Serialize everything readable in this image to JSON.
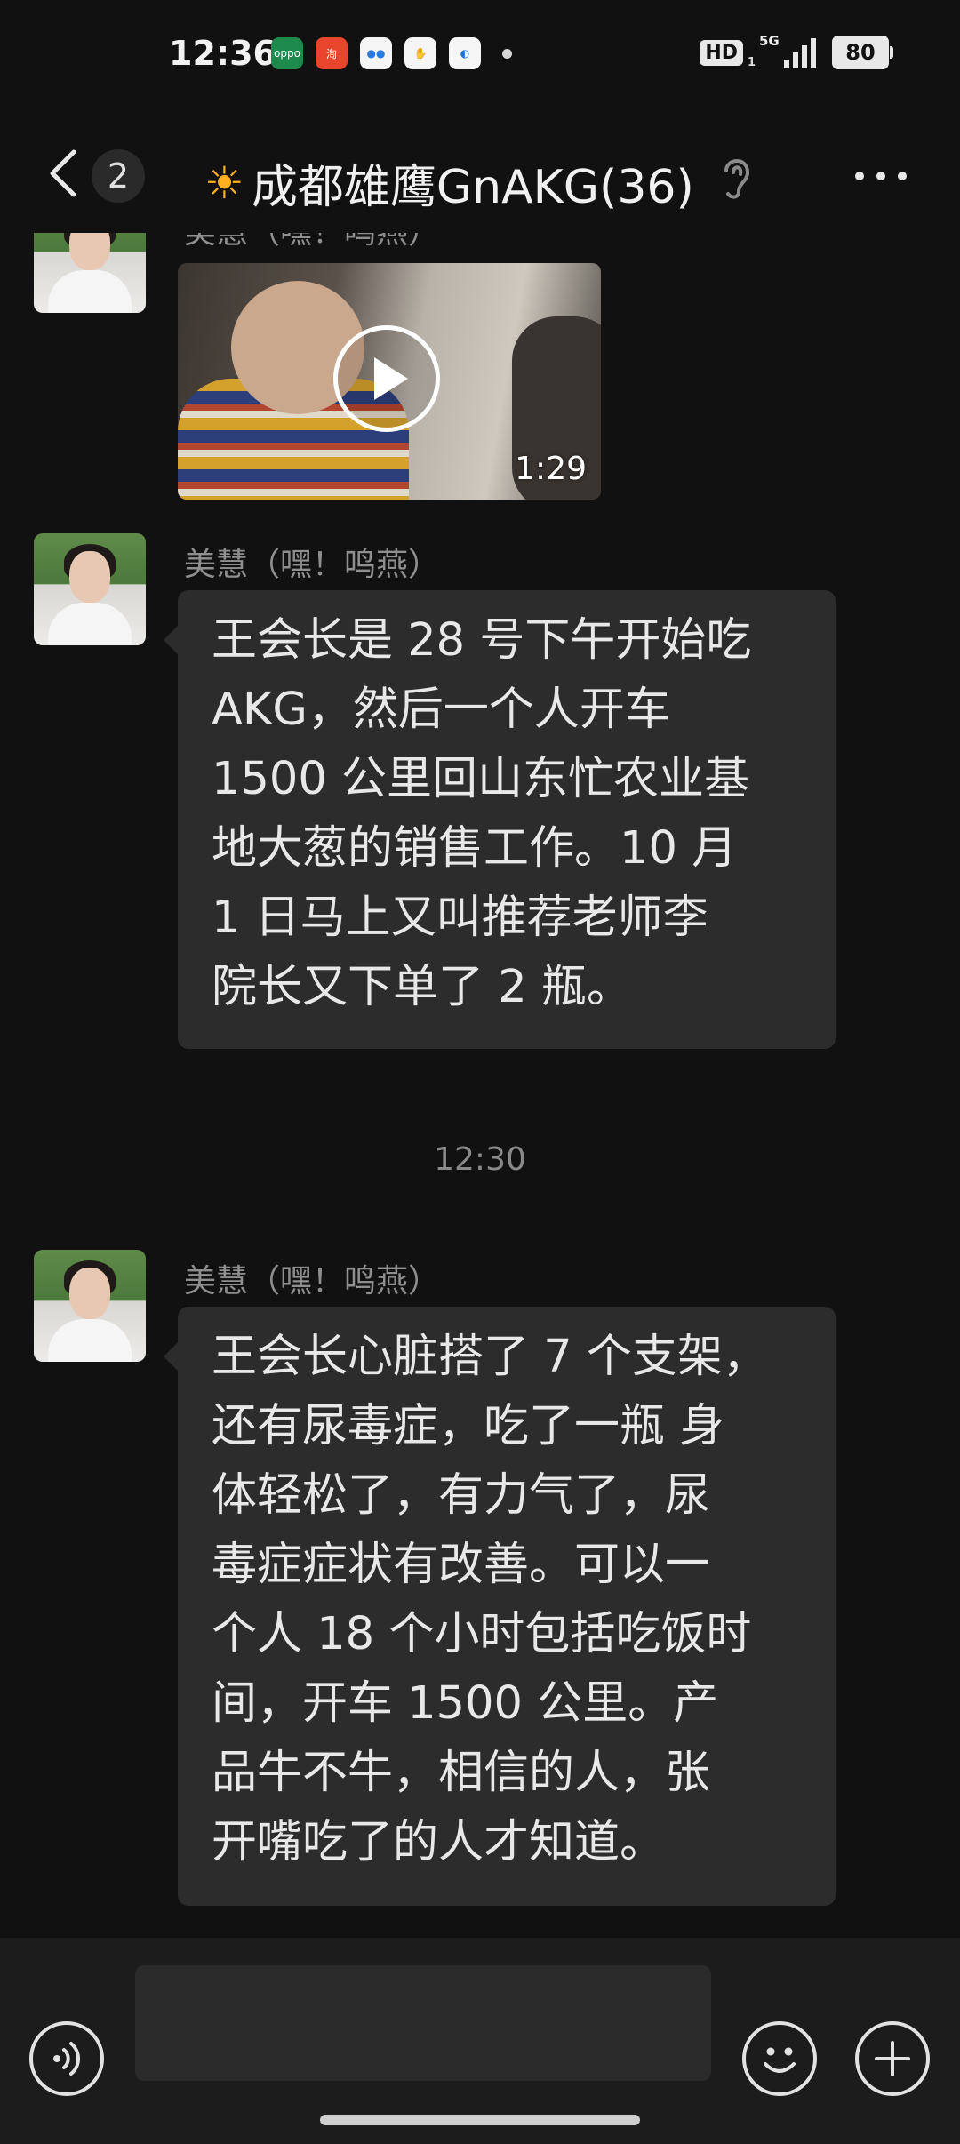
{
  "status_bar": {
    "time": "12:36",
    "app_icons": [
      "oppo-icon",
      "taobao-icon",
      "chat-bubble-icon",
      "baidu-paw-icon",
      "browser-icon"
    ],
    "hd_label": "HD",
    "hd_sub": "1",
    "network": "5G",
    "battery": "80"
  },
  "header": {
    "unread_count": "2",
    "title_emoji": "☀",
    "title": "成都雄鹰GnAKG(36)"
  },
  "messages": [
    {
      "sender": "美慧（嘿！鸣燕）",
      "type": "video",
      "duration": "1:29"
    },
    {
      "sender": "美慧（嘿！鸣燕）",
      "type": "text",
      "lines": [
        "王会长是 28 号下午开始吃",
        "AKG，然后一个人开车",
        "1500 公里回山东忙农业基",
        "地大葱的销售工作。10 月",
        "1 日马上又叫推荐老师李",
        "院长又下单了 2 瓶。"
      ]
    },
    {
      "sender": "美慧（嘿！鸣燕）",
      "type": "text",
      "lines": [
        "王会长心脏搭了 7 个支架，",
        "还有尿毒症，吃了一瓶 身",
        "体轻松了，有力气了，尿",
        "毒症症状有改善。可以一",
        "个人 18 个小时包括吃饭时",
        "间，开车 1500 公里。产",
        "品牛不牛，相信的人，张",
        "开嘴吃了的人才知道。"
      ]
    }
  ],
  "timestamp": "12:30",
  "input": {
    "value": ""
  }
}
